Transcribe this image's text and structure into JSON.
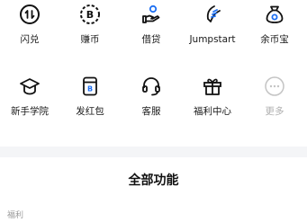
{
  "row1": [
    {
      "label": "闪兑",
      "icon": "swap-circle-icon"
    },
    {
      "label": "赚币",
      "icon": "bitcoin-dashed-circle-icon"
    },
    {
      "label": "借贷",
      "icon": "coin-hand-icon"
    },
    {
      "label": "Jumpstart",
      "icon": "rocket-flame-icon"
    },
    {
      "label": "余币宝",
      "icon": "money-bag-icon"
    }
  ],
  "row2": [
    {
      "label": "新手学院",
      "icon": "graduation-cap-icon"
    },
    {
      "label": "发红包",
      "icon": "red-packet-icon"
    },
    {
      "label": "客服",
      "icon": "headset-icon"
    },
    {
      "label": "福利中心",
      "icon": "gift-icon"
    },
    {
      "label": "更多",
      "icon": "more-circle-icon"
    }
  ],
  "section": {
    "title": "全部功能",
    "subtitle": "福利"
  },
  "colors": {
    "icon": "#111111",
    "muted": "#b0b0b0",
    "divider": "#f4f5f7"
  }
}
